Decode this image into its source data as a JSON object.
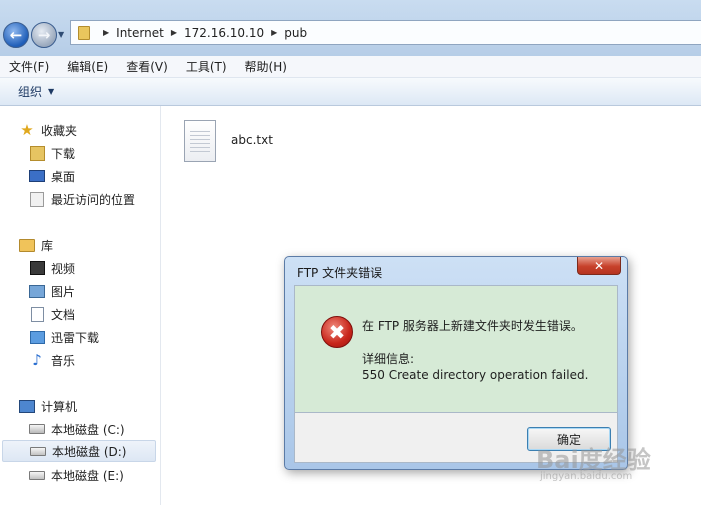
{
  "address_bar": {
    "segments": [
      "Internet",
      "172.16.10.10",
      "pub"
    ]
  },
  "menu": [
    "文件(F)",
    "编辑(E)",
    "查看(V)",
    "工具(T)",
    "帮助(H)"
  ],
  "toolbar": {
    "organize": "组织"
  },
  "nav": {
    "favorites": {
      "label": "收藏夹",
      "items": [
        "下载",
        "桌面",
        "最近访问的位置"
      ]
    },
    "libraries": {
      "label": "库",
      "items": [
        "视频",
        "图片",
        "文档",
        "迅雷下载",
        "音乐"
      ]
    },
    "computer": {
      "label": "计算机",
      "items": [
        "本地磁盘 (C:)",
        "本地磁盘 (D:)",
        "本地磁盘 (E:)"
      ]
    }
  },
  "files": [
    {
      "name": "abc.txt"
    }
  ],
  "dialog": {
    "title": "FTP 文件夹错误",
    "close_glyph": "✕",
    "message": "在 FTP 服务器上新建文件夹时发生错误。",
    "detail_label": "详细信息:",
    "detail": "550 Create directory operation failed.",
    "ok": "确定"
  },
  "watermark": {
    "main": "Bai度经验",
    "sub": "jingyan.baidu.com"
  },
  "colors": {
    "dialog_body": "#d6ead6",
    "close_button": "#c7412b",
    "error_icon": "#c8261b"
  }
}
